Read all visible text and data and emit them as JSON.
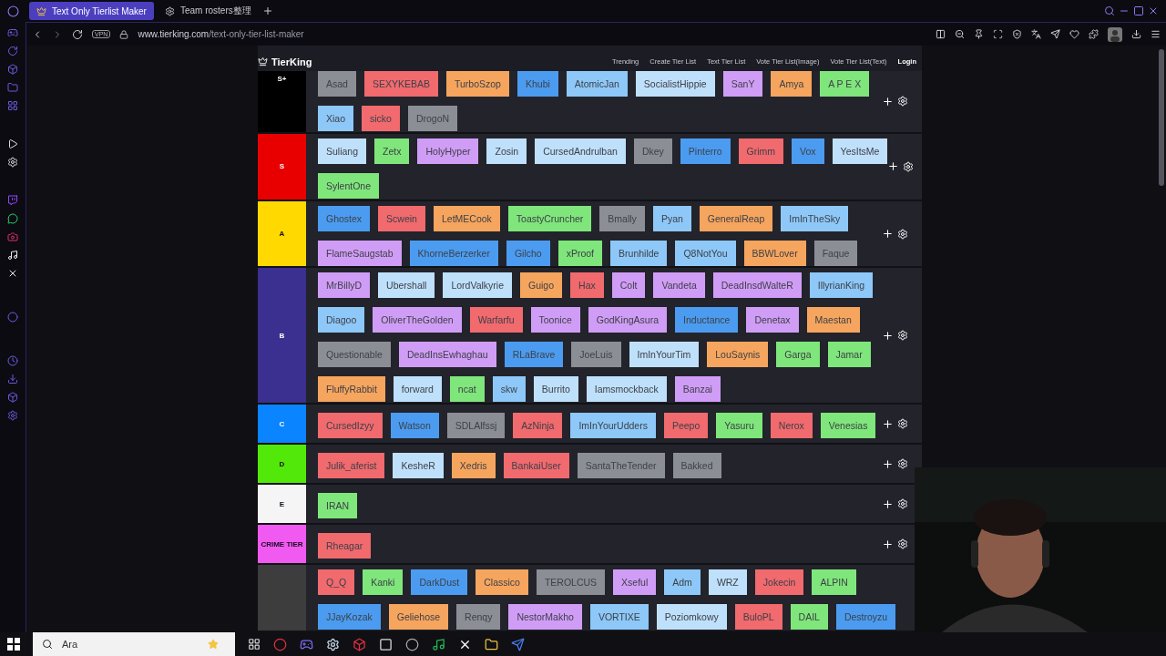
{
  "tabs": [
    {
      "label": "Text Only Tierlist Maker",
      "selected": true
    },
    {
      "label": "Team rosters整理",
      "selected": false
    }
  ],
  "address_bar": {
    "vpn_badge": "VPN",
    "url_domain": "www.tierking.com",
    "url_path": "/text-only-tier-list-maker"
  },
  "site_header": {
    "logo": "TierKing",
    "nav": [
      "Trending",
      "Create Tier List",
      "Text Tier List",
      "Vote Tier List(Image)",
      "Vote Tier List(Text)"
    ],
    "login": "Login"
  },
  "tiers": [
    {
      "label": "S+",
      "color": "#000000",
      "lines": [
        [
          {
            "name": "Asad",
            "color": "#8b8f95"
          },
          {
            "name": "SEXYKEBAB",
            "color": "#f06a6e"
          },
          {
            "name": "TurboSzop",
            "color": "#f6a55e"
          },
          {
            "name": "Khubi",
            "color": "#4b9cf0"
          },
          {
            "name": "AtomicJan",
            "color": "#8dc8f8"
          },
          {
            "name": "SocialistHippie",
            "color": "#bfe0fb"
          },
          {
            "name": "SanY",
            "color": "#d09df6"
          },
          {
            "name": "Amya",
            "color": "#f6a55e"
          },
          {
            "name": "A P E X",
            "color": "#7fe67b"
          }
        ],
        [
          {
            "name": "Xiao",
            "color": "#8dc8f8"
          },
          {
            "name": "sicko",
            "color": "#f06a6e"
          },
          {
            "name": "DrogoN",
            "color": "#8b8f95"
          }
        ]
      ]
    },
    {
      "label": "S",
      "color": "#e80000",
      "lines": [
        [
          {
            "name": "Suliang",
            "color": "#bfe0fb"
          },
          {
            "name": "Zetx",
            "color": "#7fe67b"
          },
          {
            "name": "HolyHyper",
            "color": "#d09df6"
          },
          {
            "name": "Zosin",
            "color": "#bfe0fb"
          },
          {
            "name": "CursedAndrulban",
            "color": "#bfe0fb"
          },
          {
            "name": "Dkey",
            "color": "#8b8f95"
          },
          {
            "name": "Pinterro",
            "color": "#4b9cf0"
          },
          {
            "name": "Grimm",
            "color": "#f06a6e"
          },
          {
            "name": "Vox",
            "color": "#4b9cf0"
          },
          {
            "name": "YesItsMe",
            "color": "#bfe0fb"
          }
        ],
        [
          {
            "name": "SylentOne",
            "color": "#7fe67b"
          }
        ]
      ]
    },
    {
      "label": "A",
      "color": "#ffd900",
      "lines": [
        [
          {
            "name": "Ghostex",
            "color": "#4b9cf0"
          },
          {
            "name": "Scwein",
            "color": "#f06a6e"
          },
          {
            "name": "LetMECook",
            "color": "#f6a55e"
          },
          {
            "name": "ToastyCruncher",
            "color": "#7fe67b"
          },
          {
            "name": "Bmally",
            "color": "#8b8f95"
          },
          {
            "name": "Pyan",
            "color": "#8dc8f8"
          },
          {
            "name": "GeneralReap",
            "color": "#f6a55e"
          },
          {
            "name": "ImInTheSky",
            "color": "#8dc8f8"
          }
        ],
        [
          {
            "name": "FlameSaugstab",
            "color": "#d09df6"
          },
          {
            "name": "KhorneBerzerker",
            "color": "#4b9cf0"
          },
          {
            "name": "Gilcho",
            "color": "#4b9cf0"
          },
          {
            "name": "xProof",
            "color": "#7fe67b"
          },
          {
            "name": "Brunhilde",
            "color": "#8dc8f8"
          },
          {
            "name": "Q8NotYou",
            "color": "#8dc8f8"
          },
          {
            "name": "BBWLover",
            "color": "#f6a55e"
          },
          {
            "name": "Faque",
            "color": "#8b8f95"
          }
        ]
      ]
    },
    {
      "label": "B",
      "color": "#3b2f8f",
      "lines": [
        [
          {
            "name": "MrBillyD",
            "color": "#d09df6"
          },
          {
            "name": "Ubershall",
            "color": "#bfe0fb"
          },
          {
            "name": "LordValkyrie",
            "color": "#bfe0fb"
          },
          {
            "name": "Guigo",
            "color": "#f6a55e"
          },
          {
            "name": "Hax",
            "color": "#f06a6e"
          },
          {
            "name": "Colt",
            "color": "#d09df6"
          },
          {
            "name": "Vandeta",
            "color": "#d09df6"
          },
          {
            "name": "DeadInsdWalteR",
            "color": "#d09df6"
          },
          {
            "name": "IllyrianKing",
            "color": "#8dc8f8"
          }
        ],
        [
          {
            "name": "Diagoo",
            "color": "#8dc8f8"
          },
          {
            "name": "OliverTheGolden",
            "color": "#d09df6"
          },
          {
            "name": "Warfarfu",
            "color": "#f06a6e"
          },
          {
            "name": "Toonice",
            "color": "#d09df6"
          },
          {
            "name": "GodKingAsura",
            "color": "#d09df6"
          },
          {
            "name": "Inductance",
            "color": "#4b9cf0"
          },
          {
            "name": "Denetax",
            "color": "#d09df6"
          },
          {
            "name": "Maestan",
            "color": "#f6a55e"
          }
        ],
        [
          {
            "name": "Questionable",
            "color": "#8b8f95"
          },
          {
            "name": "DeadInsEwhaghau",
            "color": "#d09df6"
          },
          {
            "name": "RLaBrave",
            "color": "#4b9cf0"
          },
          {
            "name": "JoeLuis",
            "color": "#8b8f95"
          },
          {
            "name": "ImInYourTim",
            "color": "#bfe0fb"
          },
          {
            "name": "LouSaynis",
            "color": "#f6a55e"
          },
          {
            "name": "Garga",
            "color": "#7fe67b"
          },
          {
            "name": "Jamar",
            "color": "#7fe67b"
          }
        ],
        [
          {
            "name": "FluffyRabbit",
            "color": "#f6a55e"
          },
          {
            "name": "forward",
            "color": "#bfe0fb"
          },
          {
            "name": "ncat",
            "color": "#7fe67b"
          },
          {
            "name": "skw",
            "color": "#8dc8f8"
          },
          {
            "name": "Burrito",
            "color": "#bfe0fb"
          },
          {
            "name": "Iamsmockback",
            "color": "#bfe0fb"
          },
          {
            "name": "Banzai",
            "color": "#d09df6"
          }
        ]
      ]
    },
    {
      "label": "C",
      "color": "#0a84ff",
      "lines": [
        [
          {
            "name": "CursedIzyy",
            "color": "#f06a6e"
          },
          {
            "name": "Watson",
            "color": "#4b9cf0"
          },
          {
            "name": "SDLAlfssj",
            "color": "#8b8f95"
          },
          {
            "name": "AzNinja",
            "color": "#f06a6e"
          },
          {
            "name": "ImInYourUdders",
            "color": "#8dc8f8"
          },
          {
            "name": "Peepo",
            "color": "#f06a6e"
          },
          {
            "name": "Yasuru",
            "color": "#7fe67b"
          },
          {
            "name": "Nerox",
            "color": "#f06a6e"
          },
          {
            "name": "Venesias",
            "color": "#7fe67b"
          }
        ]
      ]
    },
    {
      "label": "D",
      "color": "#52e80a",
      "lines": [
        [
          {
            "name": "Julik_aferist",
            "color": "#f06a6e"
          },
          {
            "name": "KesheR",
            "color": "#bfe0fb"
          },
          {
            "name": "Xedris",
            "color": "#f6a55e"
          },
          {
            "name": "BankaiUser",
            "color": "#f06a6e"
          },
          {
            "name": "SantaTheTender",
            "color": "#8b8f95"
          },
          {
            "name": "Bakked",
            "color": "#8b8f95"
          }
        ]
      ]
    },
    {
      "label": "E",
      "color": "#f5f5f5",
      "lines": [
        [
          {
            "name": "IRAN",
            "color": "#7fe67b"
          }
        ]
      ]
    },
    {
      "label": "CRIME TIER",
      "color": "#f05af0",
      "lines": [
        [
          {
            "name": "Rheagar",
            "color": "#f06a6e"
          }
        ]
      ]
    },
    {
      "color": "#3d3d3d",
      "lines": [
        [
          {
            "name": "Q_Q",
            "color": "#f06a6e"
          },
          {
            "name": "Kanki",
            "color": "#7fe67b"
          },
          {
            "name": "DarkDust",
            "color": "#4b9cf0"
          },
          {
            "name": "Classico",
            "color": "#f6a55e"
          },
          {
            "name": "TEROLCUS",
            "color": "#8b8f95"
          },
          {
            "name": "Xseful",
            "color": "#d09df6"
          },
          {
            "name": "Adm",
            "color": "#8dc8f8"
          },
          {
            "name": "WRZ",
            "color": "#bfe0fb"
          },
          {
            "name": "Jokecin",
            "color": "#f06a6e"
          },
          {
            "name": "ALPIN",
            "color": "#7fe67b"
          }
        ],
        [
          {
            "name": "JJayKozak",
            "color": "#4b9cf0"
          },
          {
            "name": "Geliehose",
            "color": "#f6a55e"
          },
          {
            "name": "Renqy",
            "color": "#8b8f95"
          },
          {
            "name": "NestorMakho",
            "color": "#d09df6"
          },
          {
            "name": "VORTIXE",
            "color": "#8dc8f8"
          },
          {
            "name": "Poziomkowy",
            "color": "#bfe0fb"
          },
          {
            "name": "BuloPL",
            "color": "#f06a6e"
          },
          {
            "name": "DAIL",
            "color": "#7fe67b"
          },
          {
            "name": "Destroyzu",
            "color": "#4b9cf0"
          }
        ]
      ]
    }
  ],
  "taskbar": {
    "search": {
      "placeholder": "Ara"
    }
  }
}
